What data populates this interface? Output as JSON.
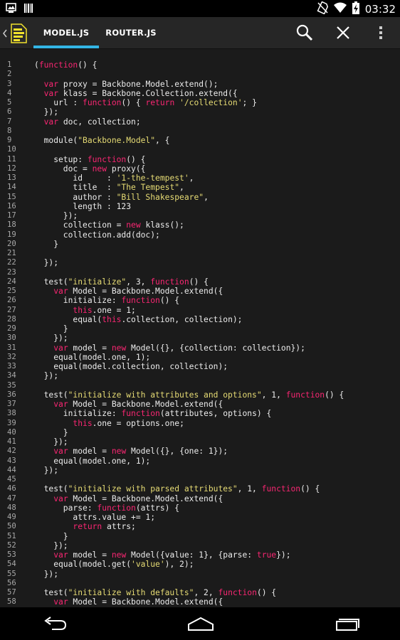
{
  "status_bar": {
    "time": "03:32",
    "icons": [
      "screenshot-icon",
      "barcode-icon",
      "no-sim-icon",
      "wifi-icon",
      "battery-charging-icon"
    ]
  },
  "app_bar": {
    "app_icon": "document-icon",
    "tabs": [
      {
        "label": "MODEL.JS",
        "active": true
      },
      {
        "label": "ROUTER.JS",
        "active": false
      }
    ],
    "actions": [
      "search-icon",
      "close-icon",
      "overflow-menu-icon"
    ],
    "accent_color": "#33b5e5"
  },
  "editor": {
    "colors": {
      "keyword": "#f92672",
      "string": "#e6db74",
      "text": "#ececec",
      "line_number": "#a8a8a8"
    },
    "lines": [
      {
        "n": "1",
        "tokens": [
          {
            "t": "(",
            "c": "pl"
          },
          {
            "t": "function",
            "c": "kw"
          },
          {
            "t": "() {",
            "c": "pl"
          }
        ]
      },
      {
        "n": "2",
        "tokens": []
      },
      {
        "n": "3",
        "tokens": [
          {
            "t": "  ",
            "c": "pl"
          },
          {
            "t": "var",
            "c": "kw"
          },
          {
            "t": " proxy = Backbone.Model.extend();",
            "c": "pl"
          }
        ]
      },
      {
        "n": "4",
        "tokens": [
          {
            "t": "  ",
            "c": "pl"
          },
          {
            "t": "var",
            "c": "kw"
          },
          {
            "t": " klass = Backbone.Collection.extend({",
            "c": "pl"
          }
        ]
      },
      {
        "n": "5",
        "tokens": [
          {
            "t": "    url : ",
            "c": "pl"
          },
          {
            "t": "function",
            "c": "kw"
          },
          {
            "t": "() { ",
            "c": "pl"
          },
          {
            "t": "return",
            "c": "kw"
          },
          {
            "t": " ",
            "c": "pl"
          },
          {
            "t": "'/collection'",
            "c": "str"
          },
          {
            "t": "; }",
            "c": "pl"
          }
        ]
      },
      {
        "n": "6",
        "tokens": [
          {
            "t": "  });",
            "c": "pl"
          }
        ]
      },
      {
        "n": "7",
        "tokens": [
          {
            "t": "  ",
            "c": "pl"
          },
          {
            "t": "var",
            "c": "kw"
          },
          {
            "t": " doc, collection;",
            "c": "pl"
          }
        ]
      },
      {
        "n": "8",
        "tokens": []
      },
      {
        "n": "9",
        "tokens": [
          {
            "t": "  module(",
            "c": "pl"
          },
          {
            "t": "\"Backbone.Model\"",
            "c": "str"
          },
          {
            "t": ", {",
            "c": "pl"
          }
        ]
      },
      {
        "n": "10",
        "tokens": []
      },
      {
        "n": "11",
        "tokens": [
          {
            "t": "    setup: ",
            "c": "pl"
          },
          {
            "t": "function",
            "c": "kw"
          },
          {
            "t": "() {",
            "c": "pl"
          }
        ]
      },
      {
        "n": "12",
        "tokens": [
          {
            "t": "      doc = ",
            "c": "pl"
          },
          {
            "t": "new",
            "c": "kw"
          },
          {
            "t": " proxy({",
            "c": "pl"
          }
        ]
      },
      {
        "n": "13",
        "tokens": [
          {
            "t": "        id     : ",
            "c": "pl"
          },
          {
            "t": "'1-the-tempest'",
            "c": "str"
          },
          {
            "t": ",",
            "c": "pl"
          }
        ]
      },
      {
        "n": "14",
        "tokens": [
          {
            "t": "        title  : ",
            "c": "pl"
          },
          {
            "t": "\"The Tempest\"",
            "c": "str"
          },
          {
            "t": ",",
            "c": "pl"
          }
        ]
      },
      {
        "n": "15",
        "tokens": [
          {
            "t": "        author : ",
            "c": "pl"
          },
          {
            "t": "\"Bill Shakespeare\"",
            "c": "str"
          },
          {
            "t": ",",
            "c": "pl"
          }
        ]
      },
      {
        "n": "16",
        "tokens": [
          {
            "t": "        length : 123",
            "c": "pl"
          }
        ]
      },
      {
        "n": "17",
        "tokens": [
          {
            "t": "      });",
            "c": "pl"
          }
        ]
      },
      {
        "n": "18",
        "tokens": [
          {
            "t": "      collection = ",
            "c": "pl"
          },
          {
            "t": "new",
            "c": "kw"
          },
          {
            "t": " klass();",
            "c": "pl"
          }
        ]
      },
      {
        "n": "19",
        "tokens": [
          {
            "t": "      collection.add(doc);",
            "c": "pl"
          }
        ]
      },
      {
        "n": "20",
        "tokens": [
          {
            "t": "    }",
            "c": "pl"
          }
        ]
      },
      {
        "n": "21",
        "tokens": []
      },
      {
        "n": "22",
        "tokens": [
          {
            "t": "  });",
            "c": "pl"
          }
        ]
      },
      {
        "n": "23",
        "tokens": []
      },
      {
        "n": "24",
        "tokens": [
          {
            "t": "  test(",
            "c": "pl"
          },
          {
            "t": "\"initialize\"",
            "c": "str"
          },
          {
            "t": ", 3, ",
            "c": "pl"
          },
          {
            "t": "function",
            "c": "kw"
          },
          {
            "t": "() {",
            "c": "pl"
          }
        ]
      },
      {
        "n": "25",
        "tokens": [
          {
            "t": "    ",
            "c": "pl"
          },
          {
            "t": "var",
            "c": "kw"
          },
          {
            "t": " Model = Backbone.Model.extend({",
            "c": "pl"
          }
        ]
      },
      {
        "n": "26",
        "tokens": [
          {
            "t": "      initialize: ",
            "c": "pl"
          },
          {
            "t": "function",
            "c": "kw"
          },
          {
            "t": "() {",
            "c": "pl"
          }
        ]
      },
      {
        "n": "27",
        "tokens": [
          {
            "t": "        ",
            "c": "pl"
          },
          {
            "t": "this",
            "c": "kw"
          },
          {
            "t": ".one = 1;",
            "c": "pl"
          }
        ]
      },
      {
        "n": "28",
        "tokens": [
          {
            "t": "        equal(",
            "c": "pl"
          },
          {
            "t": "this",
            "c": "kw"
          },
          {
            "t": ".collection, collection);",
            "c": "pl"
          }
        ]
      },
      {
        "n": "29",
        "tokens": [
          {
            "t": "      }",
            "c": "pl"
          }
        ]
      },
      {
        "n": "30",
        "tokens": [
          {
            "t": "    });",
            "c": "pl"
          }
        ]
      },
      {
        "n": "31",
        "tokens": [
          {
            "t": "    ",
            "c": "pl"
          },
          {
            "t": "var",
            "c": "kw"
          },
          {
            "t": " model = ",
            "c": "pl"
          },
          {
            "t": "new",
            "c": "kw"
          },
          {
            "t": " Model({}, {collection: collection});",
            "c": "pl"
          }
        ]
      },
      {
        "n": "32",
        "tokens": [
          {
            "t": "    equal(model.one, 1);",
            "c": "pl"
          }
        ]
      },
      {
        "n": "33",
        "tokens": [
          {
            "t": "    equal(model.collection, collection);",
            "c": "pl"
          }
        ]
      },
      {
        "n": "34",
        "tokens": [
          {
            "t": "  });",
            "c": "pl"
          }
        ]
      },
      {
        "n": "35",
        "tokens": []
      },
      {
        "n": "36",
        "tokens": [
          {
            "t": "  test(",
            "c": "pl"
          },
          {
            "t": "\"initialize with attributes and options\"",
            "c": "str"
          },
          {
            "t": ", 1, ",
            "c": "pl"
          },
          {
            "t": "function",
            "c": "kw"
          },
          {
            "t": "() {",
            "c": "pl"
          }
        ]
      },
      {
        "n": "37",
        "tokens": [
          {
            "t": "    ",
            "c": "pl"
          },
          {
            "t": "var",
            "c": "kw"
          },
          {
            "t": " Model = Backbone.Model.extend({",
            "c": "pl"
          }
        ]
      },
      {
        "n": "38",
        "tokens": [
          {
            "t": "      initialize: ",
            "c": "pl"
          },
          {
            "t": "function",
            "c": "kw"
          },
          {
            "t": "(attributes, options) {",
            "c": "pl"
          }
        ]
      },
      {
        "n": "39",
        "tokens": [
          {
            "t": "        ",
            "c": "pl"
          },
          {
            "t": "this",
            "c": "kw"
          },
          {
            "t": ".one = options.one;",
            "c": "pl"
          }
        ]
      },
      {
        "n": "40",
        "tokens": [
          {
            "t": "      }",
            "c": "pl"
          }
        ]
      },
      {
        "n": "41",
        "tokens": [
          {
            "t": "    });",
            "c": "pl"
          }
        ]
      },
      {
        "n": "42",
        "tokens": [
          {
            "t": "    ",
            "c": "pl"
          },
          {
            "t": "var",
            "c": "kw"
          },
          {
            "t": " model = ",
            "c": "pl"
          },
          {
            "t": "new",
            "c": "kw"
          },
          {
            "t": " Model({}, {one: 1});",
            "c": "pl"
          }
        ]
      },
      {
        "n": "43",
        "tokens": [
          {
            "t": "    equal(model.one, 1);",
            "c": "pl"
          }
        ]
      },
      {
        "n": "44",
        "tokens": [
          {
            "t": "  });",
            "c": "pl"
          }
        ]
      },
      {
        "n": "45",
        "tokens": []
      },
      {
        "n": "46",
        "tokens": [
          {
            "t": "  test(",
            "c": "pl"
          },
          {
            "t": "\"initialize with parsed attributes\"",
            "c": "str"
          },
          {
            "t": ", 1, ",
            "c": "pl"
          },
          {
            "t": "function",
            "c": "kw"
          },
          {
            "t": "() {",
            "c": "pl"
          }
        ]
      },
      {
        "n": "47",
        "tokens": [
          {
            "t": "    ",
            "c": "pl"
          },
          {
            "t": "var",
            "c": "kw"
          },
          {
            "t": " Model = Backbone.Model.extend({",
            "c": "pl"
          }
        ]
      },
      {
        "n": "48",
        "tokens": [
          {
            "t": "      parse: ",
            "c": "pl"
          },
          {
            "t": "function",
            "c": "kw"
          },
          {
            "t": "(attrs) {",
            "c": "pl"
          }
        ]
      },
      {
        "n": "49",
        "tokens": [
          {
            "t": "        attrs.value += 1;",
            "c": "pl"
          }
        ]
      },
      {
        "n": "50",
        "tokens": [
          {
            "t": "        ",
            "c": "pl"
          },
          {
            "t": "return",
            "c": "kw"
          },
          {
            "t": " attrs;",
            "c": "pl"
          }
        ]
      },
      {
        "n": "51",
        "tokens": [
          {
            "t": "      }",
            "c": "pl"
          }
        ]
      },
      {
        "n": "52",
        "tokens": [
          {
            "t": "    });",
            "c": "pl"
          }
        ]
      },
      {
        "n": "53",
        "tokens": [
          {
            "t": "    ",
            "c": "pl"
          },
          {
            "t": "var",
            "c": "kw"
          },
          {
            "t": " model = ",
            "c": "pl"
          },
          {
            "t": "new",
            "c": "kw"
          },
          {
            "t": " Model({value: 1}, {parse: ",
            "c": "pl"
          },
          {
            "t": "true",
            "c": "kw"
          },
          {
            "t": "});",
            "c": "pl"
          }
        ]
      },
      {
        "n": "54",
        "tokens": [
          {
            "t": "    equal(model.get(",
            "c": "pl"
          },
          {
            "t": "'value'",
            "c": "str"
          },
          {
            "t": "), 2);",
            "c": "pl"
          }
        ]
      },
      {
        "n": "55",
        "tokens": [
          {
            "t": "  });",
            "c": "pl"
          }
        ]
      },
      {
        "n": "56",
        "tokens": []
      },
      {
        "n": "57",
        "tokens": [
          {
            "t": "  test(",
            "c": "pl"
          },
          {
            "t": "\"initialize with defaults\"",
            "c": "str"
          },
          {
            "t": ", 2, ",
            "c": "pl"
          },
          {
            "t": "function",
            "c": "kw"
          },
          {
            "t": "() {",
            "c": "pl"
          }
        ]
      },
      {
        "n": "58",
        "tokens": [
          {
            "t": "    ",
            "c": "pl"
          },
          {
            "t": "var",
            "c": "kw"
          },
          {
            "t": " Model = Backbone.Model.extend({",
            "c": "pl"
          }
        ]
      }
    ]
  },
  "nav_bar": {
    "buttons": [
      "back-icon",
      "home-icon",
      "recents-icon"
    ]
  }
}
